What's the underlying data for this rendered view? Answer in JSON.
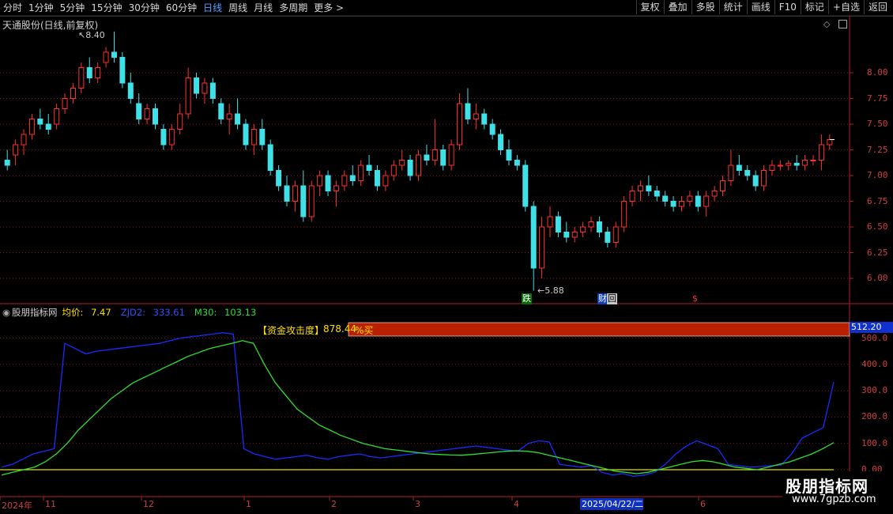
{
  "toolbar": {
    "periods": [
      "分时",
      "1分钟",
      "5分钟",
      "15分钟",
      "30分钟",
      "60分钟",
      "日线",
      "周线",
      "月线",
      "多周期",
      "更多"
    ],
    "active_period": "日线",
    "buttons": [
      "复权",
      "叠加",
      "多股",
      "统计",
      "画线",
      "F10",
      "标记",
      "+自选",
      "返回"
    ]
  },
  "main_chart": {
    "title": "天通股份(日线,前复权)",
    "high_label": "8.40",
    "low_label": "5.88",
    "price_ticks": [
      "8.00",
      "7.75",
      "7.50",
      "7.25",
      "7.00",
      "6.75",
      "6.50",
      "6.25",
      "6.00"
    ],
    "markers": {
      "die": "跌",
      "cai": "财",
      "hui": "回",
      "s": "$"
    }
  },
  "indicator": {
    "name": "股朋指标网",
    "avg_label": "均价:",
    "avg_value": "7.47",
    "zjd2_label": "ZJD2:",
    "zjd2_value": "333.61",
    "m30_label": "M30:",
    "m30_value": "103.13",
    "attack_label": "【资金攻击度】",
    "attack_value": "878.44",
    "attack_pct": "%买",
    "side_value": "512.20",
    "ticks": [
      "500.0",
      "400.0",
      "300.0",
      "200.0",
      "100.0",
      "0.00"
    ]
  },
  "x_axis": {
    "labels": [
      "2024年",
      "11",
      "12",
      "1",
      "2",
      "3",
      "4",
      "6"
    ],
    "cursor_date": "2025/04/22/二"
  },
  "watermark": {
    "title": "股朋指标网",
    "url": "www.7gpzb.com"
  },
  "colors": {
    "up": "#ff3030",
    "down": "#40e0e8",
    "zjd2": "#1a2cff",
    "m30": "#30e030",
    "zero": "#e0e000",
    "bar": "#b82000"
  },
  "chart_data": [
    {
      "type": "candlestick",
      "title": "天通股份(日线,前复权)",
      "ylim": [
        5.8,
        8.55
      ],
      "yticks": [
        6.0,
        6.25,
        6.5,
        6.75,
        7.0,
        7.25,
        7.5,
        7.75,
        8.0
      ],
      "high": 8.4,
      "low": 5.88,
      "candles": [
        [
          7.15,
          7.25,
          7.05,
          7.1
        ],
        [
          7.2,
          7.35,
          7.1,
          7.3
        ],
        [
          7.3,
          7.45,
          7.2,
          7.4
        ],
        [
          7.4,
          7.6,
          7.35,
          7.55
        ],
        [
          7.55,
          7.65,
          7.45,
          7.5
        ],
        [
          7.5,
          7.6,
          7.4,
          7.45
        ],
        [
          7.5,
          7.7,
          7.45,
          7.65
        ],
        [
          7.65,
          7.8,
          7.6,
          7.75
        ],
        [
          7.75,
          7.9,
          7.7,
          7.85
        ],
        [
          7.85,
          8.1,
          7.8,
          8.05
        ],
        [
          8.05,
          8.15,
          7.9,
          7.95
        ],
        [
          7.95,
          8.1,
          7.9,
          8.05
        ],
        [
          8.1,
          8.25,
          8.05,
          8.2
        ],
        [
          8.2,
          8.4,
          8.1,
          8.15
        ],
        [
          8.15,
          8.2,
          7.85,
          7.9
        ],
        [
          7.9,
          8.0,
          7.7,
          7.75
        ],
        [
          7.7,
          7.8,
          7.5,
          7.55
        ],
        [
          7.55,
          7.7,
          7.5,
          7.65
        ],
        [
          7.65,
          7.7,
          7.45,
          7.5
        ],
        [
          7.45,
          7.5,
          7.25,
          7.3
        ],
        [
          7.3,
          7.5,
          7.25,
          7.45
        ],
        [
          7.45,
          7.7,
          7.4,
          7.6
        ],
        [
          7.6,
          8.05,
          7.55,
          7.95
        ],
        [
          7.95,
          8.0,
          7.75,
          7.8
        ],
        [
          7.8,
          7.95,
          7.7,
          7.9
        ],
        [
          7.9,
          7.95,
          7.7,
          7.75
        ],
        [
          7.7,
          7.75,
          7.5,
          7.55
        ],
        [
          7.55,
          7.7,
          7.4,
          7.6
        ],
        [
          7.6,
          7.75,
          7.45,
          7.5
        ],
        [
          7.5,
          7.55,
          7.25,
          7.3
        ],
        [
          7.3,
          7.5,
          7.2,
          7.45
        ],
        [
          7.45,
          7.55,
          7.25,
          7.3
        ],
        [
          7.3,
          7.35,
          7.0,
          7.05
        ],
        [
          7.05,
          7.1,
          6.85,
          6.9
        ],
        [
          6.9,
          7.0,
          6.7,
          6.75
        ],
        [
          6.75,
          6.95,
          6.65,
          6.9
        ],
        [
          6.9,
          7.05,
          6.55,
          6.6
        ],
        [
          6.6,
          6.95,
          6.55,
          6.9
        ],
        [
          6.9,
          7.05,
          6.8,
          7.0
        ],
        [
          7.0,
          7.05,
          6.8,
          6.85
        ],
        [
          6.85,
          6.95,
          6.7,
          6.9
        ],
        [
          6.9,
          7.05,
          6.85,
          7.0
        ],
        [
          7.0,
          7.1,
          6.9,
          6.95
        ],
        [
          6.95,
          7.15,
          6.9,
          7.1
        ],
        [
          7.1,
          7.2,
          7.0,
          7.05
        ],
        [
          7.05,
          7.1,
          6.85,
          6.9
        ],
        [
          6.9,
          7.05,
          6.85,
          7.0
        ],
        [
          7.0,
          7.15,
          6.95,
          7.1
        ],
        [
          7.1,
          7.25,
          7.05,
          7.15
        ],
        [
          7.15,
          7.2,
          6.95,
          7.0
        ],
        [
          7.0,
          7.25,
          6.95,
          7.2
        ],
        [
          7.2,
          7.3,
          7.1,
          7.15
        ],
        [
          7.15,
          7.55,
          7.1,
          7.25
        ],
        [
          7.25,
          7.3,
          7.05,
          7.1
        ],
        [
          7.1,
          7.35,
          7.05,
          7.3
        ],
        [
          7.3,
          7.8,
          7.25,
          7.7
        ],
        [
          7.7,
          7.85,
          7.5,
          7.55
        ],
        [
          7.55,
          7.7,
          7.45,
          7.6
        ],
        [
          7.6,
          7.65,
          7.45,
          7.5
        ],
        [
          7.5,
          7.55,
          7.35,
          7.4
        ],
        [
          7.4,
          7.45,
          7.2,
          7.25
        ],
        [
          7.25,
          7.35,
          7.1,
          7.15
        ],
        [
          7.15,
          7.2,
          7.05,
          7.1
        ],
        [
          7.1,
          7.15,
          6.65,
          6.7
        ],
        [
          6.7,
          6.75,
          5.88,
          6.1
        ],
        [
          6.1,
          6.6,
          6.0,
          6.5
        ],
        [
          6.5,
          6.7,
          6.4,
          6.6
        ],
        [
          6.6,
          6.65,
          6.4,
          6.45
        ],
        [
          6.45,
          6.55,
          6.35,
          6.4
        ],
        [
          6.4,
          6.5,
          6.35,
          6.45
        ],
        [
          6.45,
          6.55,
          6.4,
          6.5
        ],
        [
          6.5,
          6.6,
          6.45,
          6.55
        ],
        [
          6.55,
          6.6,
          6.4,
          6.45
        ],
        [
          6.45,
          6.5,
          6.3,
          6.35
        ],
        [
          6.35,
          6.55,
          6.3,
          6.5
        ],
        [
          6.5,
          6.8,
          6.45,
          6.75
        ],
        [
          6.75,
          6.9,
          6.7,
          6.85
        ],
        [
          6.85,
          6.95,
          6.75,
          6.9
        ],
        [
          6.9,
          7.0,
          6.8,
          6.85
        ],
        [
          6.85,
          6.9,
          6.75,
          6.8
        ],
        [
          6.8,
          6.85,
          6.7,
          6.75
        ],
        [
          6.75,
          6.8,
          6.65,
          6.7
        ],
        [
          6.7,
          6.8,
          6.65,
          6.75
        ],
        [
          6.75,
          6.85,
          6.7,
          6.8
        ],
        [
          6.8,
          6.85,
          6.65,
          6.7
        ],
        [
          6.7,
          6.85,
          6.6,
          6.8
        ],
        [
          6.8,
          6.9,
          6.75,
          6.85
        ],
        [
          6.85,
          7.0,
          6.8,
          6.95
        ],
        [
          6.95,
          7.25,
          6.9,
          7.1
        ],
        [
          7.1,
          7.2,
          7.0,
          7.05
        ],
        [
          7.05,
          7.1,
          6.95,
          7.0
        ],
        [
          7.0,
          7.05,
          6.85,
          6.9
        ],
        [
          6.9,
          7.1,
          6.85,
          7.05
        ],
        [
          7.05,
          7.15,
          7.0,
          7.1
        ],
        [
          7.1,
          7.15,
          7.05,
          7.1
        ],
        [
          7.1,
          7.15,
          7.05,
          7.12
        ],
        [
          7.12,
          7.2,
          7.05,
          7.1
        ],
        [
          7.1,
          7.2,
          7.05,
          7.15
        ],
        [
          7.15,
          7.2,
          7.1,
          7.15
        ],
        [
          7.15,
          7.4,
          7.05,
          7.3
        ],
        [
          7.3,
          7.4,
          7.25,
          7.35
        ]
      ]
    },
    {
      "type": "line",
      "ylim": [
        -30,
        520
      ],
      "yticks": [
        0,
        100,
        200,
        300,
        400,
        500
      ],
      "series": [
        {
          "name": "ZJD2",
          "values": [
            10,
            20,
            40,
            60,
            70,
            80,
            480,
            460,
            440,
            450,
            455,
            460,
            465,
            470,
            475,
            480,
            490,
            500,
            505,
            510,
            515,
            520,
            515,
            80,
            60,
            50,
            40,
            45,
            50,
            55,
            45,
            40,
            50,
            55,
            60,
            50,
            45,
            50,
            55,
            60,
            65,
            70,
            75,
            80,
            85,
            90,
            85,
            80,
            75,
            70,
            100,
            110,
            105,
            20,
            15,
            10,
            15,
            -10,
            -20,
            -15,
            -25,
            -20,
            -10,
            20,
            60,
            90,
            110,
            95,
            80,
            20,
            15,
            10,
            12,
            15,
            18,
            60,
            120,
            140,
            160,
            333
          ]
        },
        {
          "name": "M30",
          "values": [
            -20,
            -10,
            0,
            10,
            30,
            60,
            100,
            150,
            190,
            230,
            270,
            300,
            330,
            350,
            370,
            390,
            410,
            430,
            445,
            460,
            470,
            480,
            490,
            480,
            400,
            330,
            280,
            230,
            200,
            170,
            150,
            130,
            115,
            100,
            90,
            80,
            75,
            70,
            65,
            60,
            58,
            56,
            55,
            58,
            62,
            66,
            70,
            72,
            70,
            65,
            55,
            45,
            35,
            25,
            15,
            5,
            -5,
            -10,
            -15,
            -10,
            0,
            10,
            20,
            30,
            35,
            30,
            20,
            10,
            5,
            0,
            10,
            20,
            30,
            45,
            60,
            80,
            103
          ]
        }
      ]
    }
  ]
}
